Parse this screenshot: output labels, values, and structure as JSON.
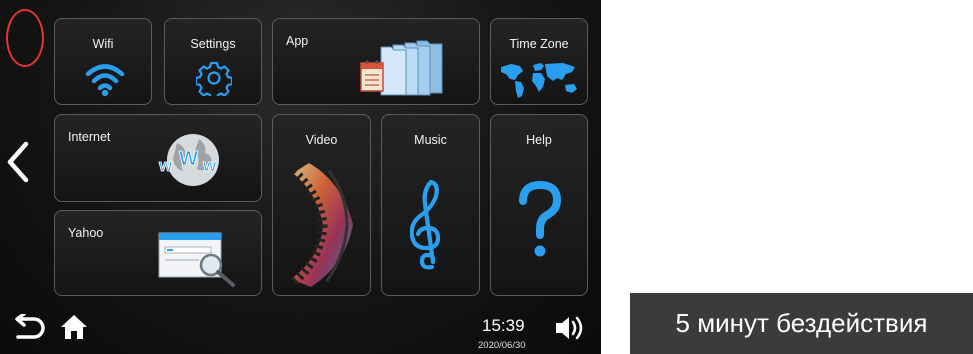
{
  "tiles": {
    "wifi": "Wifi",
    "settings": "Settings",
    "app": "App",
    "time_zone": "Time Zone",
    "internet": "Internet",
    "video": "Video",
    "music": "Music",
    "help": "Help",
    "yahoo": "Yahoo"
  },
  "status": {
    "time": "15:39",
    "date": "2020/06/30"
  },
  "toast": "5 минут бездействия",
  "icons": {
    "back": "chevron-left-icon",
    "return": "return-arrow-icon",
    "home": "home-icon",
    "volume": "speaker-icon"
  },
  "colors": {
    "accent": "#2a9ff0",
    "annotation": "#e23535",
    "toast_bg": "#3b3b3b"
  }
}
